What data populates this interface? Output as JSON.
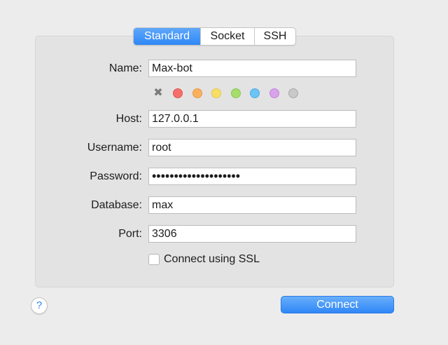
{
  "tabs": [
    {
      "label": "Standard",
      "active": true
    },
    {
      "label": "Socket",
      "active": false
    },
    {
      "label": "SSH",
      "active": false
    }
  ],
  "form": {
    "name_label": "Name:",
    "name_value": "Max-bot",
    "host_label": "Host:",
    "host_value": "127.0.0.1",
    "username_label": "Username:",
    "username_value": "root",
    "password_label": "Password:",
    "password_value": "••••••••••••••••••••",
    "database_label": "Database:",
    "database_value": "max",
    "port_label": "Port:",
    "port_value": "3306",
    "ssl_label": "Connect using SSL",
    "ssl_checked": false
  },
  "color_tags": {
    "clear_icon": "close-icon",
    "colors": [
      {
        "name": "red",
        "fill": "#f5706a",
        "border": "#e0554f"
      },
      {
        "name": "orange",
        "fill": "#f9b160",
        "border": "#e69a45"
      },
      {
        "name": "yellow",
        "fill": "#f7df67",
        "border": "#e3c94a"
      },
      {
        "name": "green",
        "fill": "#a6dd6c",
        "border": "#8ac753"
      },
      {
        "name": "blue",
        "fill": "#6cc4f5",
        "border": "#4fabe0"
      },
      {
        "name": "purple",
        "fill": "#d9a3ec",
        "border": "#c285d8"
      },
      {
        "name": "gray",
        "fill": "#c9c9c9",
        "border": "#a9a9a9"
      }
    ]
  },
  "footer": {
    "help_label": "?",
    "connect_label": "Connect"
  },
  "colors": {
    "accent": "#2f87f6",
    "window_bg": "#ececec",
    "panel_bg": "#e3e3e3"
  }
}
